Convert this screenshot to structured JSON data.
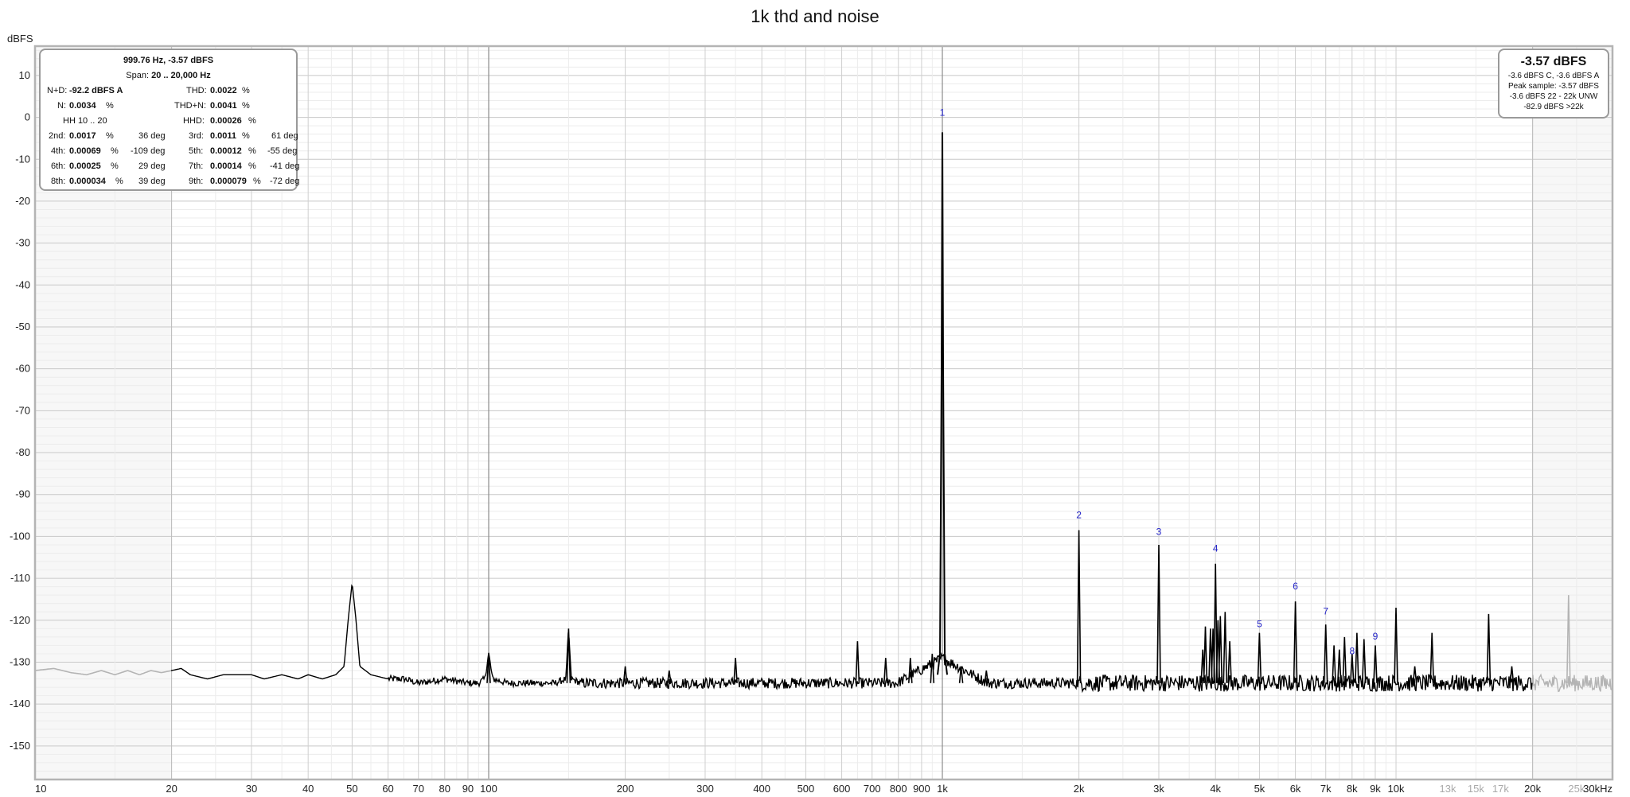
{
  "title": "1k thd and noise",
  "y_unit": "dBFS",
  "stats": {
    "header": "999.76 Hz, -3.57 dBFS",
    "span_label": "Span:",
    "span_value": "20 .. 20,000 Hz",
    "nd_label": "N+D:",
    "nd_value": "-92.2 dBFS A",
    "thd_label": "THD:",
    "thd_value": "0.0022",
    "n_label": "N:",
    "n_value": "0.0034",
    "thdn_label": "THD+N:",
    "thdn_value": "0.0041",
    "hh_label": "HH 10 .. 20",
    "hhd_label": "HHD:",
    "hhd_value": "0.00026",
    "pct": "%",
    "harmonics": [
      {
        "label": "2nd:",
        "value": "0.0017",
        "phase": "36 deg"
      },
      {
        "label": "3rd:",
        "value": "0.0011",
        "phase": "61 deg"
      },
      {
        "label": "4th:",
        "value": "0.00069",
        "phase": "-109 deg"
      },
      {
        "label": "5th:",
        "value": "0.00012",
        "phase": "-55 deg"
      },
      {
        "label": "6th:",
        "value": "0.00025",
        "phase": "29 deg"
      },
      {
        "label": "7th:",
        "value": "0.00014",
        "phase": "-41 deg"
      },
      {
        "label": "8th:",
        "value": "0.000034",
        "phase": "39 deg"
      },
      {
        "label": "9th:",
        "value": "0.000079",
        "phase": "-72 deg"
      }
    ]
  },
  "level_box": {
    "main": "-3.57 dBFS",
    "line1": "-3.6 dBFS C, -3.6 dBFS A",
    "line2": "Peak sample: -3.57 dBFS",
    "line3": "-3.6 dBFS 22 - 22k UNW",
    "line4": "-82.9 dBFS >22k"
  },
  "colors": {
    "trace": "#000000",
    "trace_outside_span": "#b4b4b4",
    "harmonic_labels": "#2323c8",
    "grid_major": "#8c8c8c",
    "grid_minor": "#d2d2d2",
    "frame": "#b4b4b4"
  },
  "chart_data": {
    "type": "line",
    "title": "1k thd and noise",
    "xscale": "log",
    "xlim": [
      10,
      30000
    ],
    "ylim": [
      -158,
      17
    ],
    "ylabel": "dBFS",
    "xlabel": "",
    "grid": true,
    "analysis_span_hz": [
      20,
      20000
    ],
    "y_ticks": [
      10,
      0,
      -10,
      -20,
      -30,
      -40,
      -50,
      -60,
      -70,
      -80,
      -90,
      -100,
      -110,
      -120,
      -130,
      -140,
      -150
    ],
    "y_tick_labels": [
      "10",
      "0",
      "-10",
      "-20",
      "-30",
      "-40",
      "-50",
      "-60",
      "-70",
      "-80",
      "-90",
      "-100",
      "-110",
      "-120",
      "-130",
      "-140",
      "-150"
    ],
    "x_ticks": [
      {
        "f": 10,
        "label": "10"
      },
      {
        "f": 20,
        "label": "20"
      },
      {
        "f": 30,
        "label": "30"
      },
      {
        "f": 40,
        "label": "40"
      },
      {
        "f": 50,
        "label": "50"
      },
      {
        "f": 60,
        "label": "60"
      },
      {
        "f": 70,
        "label": "70"
      },
      {
        "f": 80,
        "label": "80"
      },
      {
        "f": 90,
        "label": "90"
      },
      {
        "f": 100,
        "label": "100"
      },
      {
        "f": 200,
        "label": "200"
      },
      {
        "f": 300,
        "label": "300"
      },
      {
        "f": 400,
        "label": "400"
      },
      {
        "f": 500,
        "label": "500"
      },
      {
        "f": 600,
        "label": "600"
      },
      {
        "f": 700,
        "label": "700"
      },
      {
        "f": 800,
        "label": "800"
      },
      {
        "f": 900,
        "label": "900"
      },
      {
        "f": 1000,
        "label": "1k"
      },
      {
        "f": 2000,
        "label": "2k"
      },
      {
        "f": 3000,
        "label": "3k"
      },
      {
        "f": 4000,
        "label": "4k"
      },
      {
        "f": 5000,
        "label": "5k"
      },
      {
        "f": 6000,
        "label": "6k"
      },
      {
        "f": 7000,
        "label": "7k"
      },
      {
        "f": 8000,
        "label": "8k"
      },
      {
        "f": 9000,
        "label": "9k"
      },
      {
        "f": 10000,
        "label": "10k"
      },
      {
        "f": 13000,
        "label": "13k"
      },
      {
        "f": 15000,
        "label": "15k"
      },
      {
        "f": 17000,
        "label": "17k"
      },
      {
        "f": 20000,
        "label": "20k"
      },
      {
        "f": 25000,
        "label": "25k"
      },
      {
        "f": 30000,
        "label": "30kHz"
      }
    ],
    "grey_x_ticks": [
      "13k",
      "15k",
      "17k",
      "25k"
    ],
    "harmonic_labels": [
      {
        "n": "1",
        "f": 1000,
        "db": 0
      },
      {
        "n": "2",
        "f": 2000,
        "db": -96
      },
      {
        "n": "3",
        "f": 3000,
        "db": -100
      },
      {
        "n": "4",
        "f": 4000,
        "db": -104
      },
      {
        "n": "5",
        "f": 5000,
        "db": -122
      },
      {
        "n": "6",
        "f": 6000,
        "db": -113
      },
      {
        "n": "7",
        "f": 7000,
        "db": -119
      },
      {
        "n": "8",
        "f": 8000,
        "db": -128.5
      },
      {
        "n": "9",
        "f": 9000,
        "db": -125
      }
    ],
    "noise_floor_db": -135,
    "low_frequency_curve": [
      [
        10,
        -132
      ],
      [
        11,
        -131.5
      ],
      [
        12,
        -132.5
      ],
      [
        13,
        -133
      ],
      [
        14,
        -132
      ],
      [
        15,
        -133
      ],
      [
        16,
        -132
      ],
      [
        17,
        -133
      ],
      [
        18,
        -132
      ],
      [
        19,
        -132.5
      ],
      [
        20,
        -132
      ],
      [
        21,
        -131.5
      ],
      [
        22,
        -133
      ],
      [
        24,
        -134
      ],
      [
        26,
        -133
      ],
      [
        28,
        -133
      ],
      [
        30,
        -133
      ],
      [
        32,
        -134
      ],
      [
        35,
        -133
      ],
      [
        38,
        -134
      ],
      [
        40,
        -133
      ],
      [
        43,
        -134
      ],
      [
        46,
        -133
      ],
      [
        48,
        -131
      ],
      [
        49,
        -120
      ],
      [
        50,
        -111
      ],
      [
        51,
        -120
      ],
      [
        52,
        -131
      ],
      [
        55,
        -133
      ],
      [
        60,
        -134
      ],
      [
        65,
        -134
      ],
      [
        70,
        -135
      ],
      [
        80,
        -134
      ],
      [
        90,
        -135
      ],
      [
        95,
        -135
      ],
      [
        98,
        -134
      ],
      [
        100,
        -128
      ],
      [
        102,
        -134
      ],
      [
        110,
        -135
      ],
      [
        120,
        -135
      ],
      [
        140,
        -135
      ],
      [
        148,
        -134
      ],
      [
        150,
        -122
      ],
      [
        152,
        -134
      ],
      [
        160,
        -135
      ]
    ],
    "spurs": [
      [
        100,
        -128
      ],
      [
        150,
        -122
      ],
      [
        200,
        -131
      ],
      [
        250,
        -132
      ],
      [
        350,
        -129
      ],
      [
        650,
        -125
      ],
      [
        750,
        -129
      ],
      [
        850,
        -129
      ],
      [
        950,
        -128
      ],
      [
        1100,
        -131
      ],
      [
        1250,
        -132
      ],
      [
        2000,
        -98.5
      ],
      [
        3000,
        -102
      ],
      [
        3750,
        -127
      ],
      [
        3800,
        -121.5
      ],
      [
        3900,
        -122
      ],
      [
        3950,
        -122
      ],
      [
        4000,
        -106.5
      ],
      [
        4050,
        -120
      ],
      [
        4100,
        -119
      ],
      [
        4200,
        -118
      ],
      [
        4300,
        -125
      ],
      [
        5000,
        -123
      ],
      [
        6000,
        -115.5
      ],
      [
        7000,
        -121
      ],
      [
        7300,
        -126
      ],
      [
        7500,
        -127
      ],
      [
        7700,
        -124
      ],
      [
        8000,
        -128
      ],
      [
        8200,
        -123
      ],
      [
        8500,
        -124.5
      ],
      [
        9000,
        -126
      ],
      [
        10000,
        -117
      ],
      [
        11000,
        -131
      ],
      [
        12000,
        -123
      ],
      [
        16000,
        -118.5
      ],
      [
        18000,
        -131
      ],
      [
        24000,
        -114
      ]
    ],
    "series": [
      {
        "name": "",
        "values": "spectrum"
      }
    ]
  }
}
